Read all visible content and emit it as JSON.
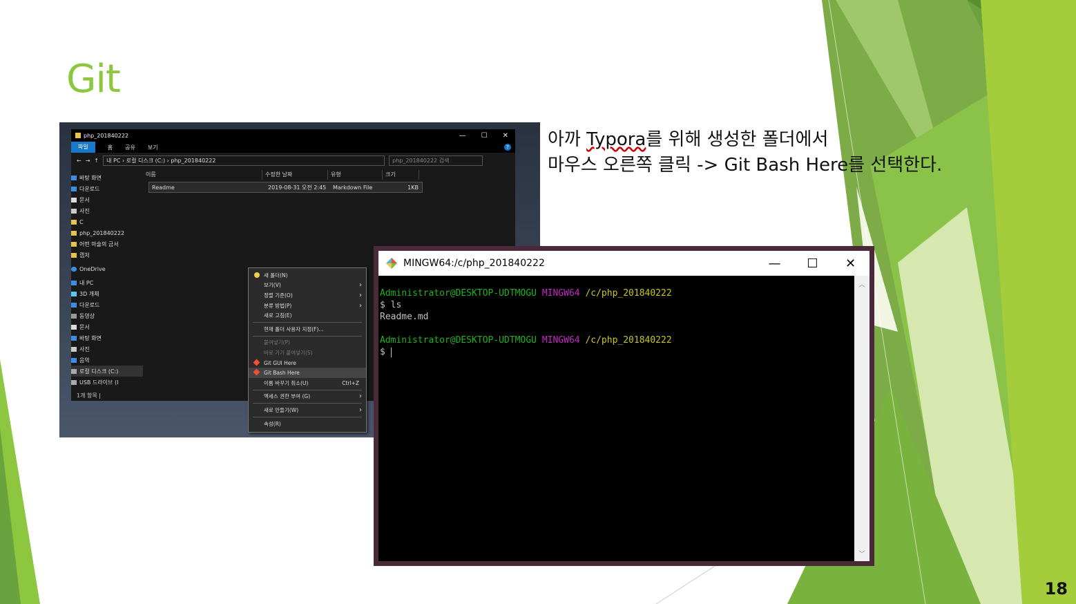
{
  "slide": {
    "title": "Git",
    "description_line1_pre": "아까 ",
    "description_line1_link": "Typora",
    "description_line1_post": "를 위해 생성한 폴더에서",
    "description_line2": "마우스 오른쪽 클릭 -> Git Bash Here를 선택한다.",
    "page_number": "18"
  },
  "explorer": {
    "window_title": "php_201840222",
    "ribbon_tabs": [
      "파일",
      "홈",
      "공유",
      "보기"
    ],
    "address_path": "내 PC  ›  로컬 디스크 (C:)  ›  php_201840222",
    "search_placeholder": "php_201840222 검색",
    "nav_items": [
      "바탕 화면",
      "다운로드",
      "문서",
      "사진",
      "C",
      "php_201840222",
      "어떤 마술의 금서",
      "캡처",
      "OneDrive",
      "내 PC",
      "3D 개체",
      "다운로드",
      "동영상",
      "문서",
      "바탕 화면",
      "사진",
      "음악",
      "로컬 디스크 (C:)",
      "USB 드라이브 (I"
    ],
    "columns": [
      "이름",
      "수정한 날짜",
      "유형",
      "크기"
    ],
    "file": {
      "name": "Readme",
      "modified": "2019-08-31 오전 2:45",
      "type": "Markdown File",
      "size": "1KB"
    },
    "status": "1개 항목  |"
  },
  "context_menu": {
    "items": [
      {
        "label": "새 폴더(N)"
      },
      {
        "label": "보기(V)"
      },
      {
        "label": "정렬 기준(O)"
      },
      {
        "label": "분류 방법(P)"
      },
      {
        "label": "새로 고침(E)"
      },
      {
        "label": "현재 폴더 사용자 지정(F)..."
      },
      {
        "label": "붙여넣기(P)"
      },
      {
        "label": "바로 가기 붙여넣기(S)"
      },
      {
        "label": "Git GUI Here"
      },
      {
        "label": "Git Bash Here"
      },
      {
        "label": "이름 바꾸기 취소(U)",
        "shortcut": "Ctrl+Z"
      },
      {
        "label": "액세스 권한 부여 (G)"
      },
      {
        "label": "새로 만들기(W)"
      },
      {
        "label": "속성(R)"
      }
    ]
  },
  "terminal": {
    "title": "MINGW64:/c/php_201840222",
    "user_host": "Administrator@DESKTOP-UDTMOGU",
    "env": "MINGW64",
    "cwd": "/c/php_201840222",
    "command": "$ ls",
    "output": "Readme.md",
    "prompt": "$ "
  },
  "colors": {
    "accent": "#8dc63f",
    "terminal_green": "#1db31d",
    "terminal_magenta": "#c227c2",
    "terminal_yellow": "#c7c71d"
  }
}
